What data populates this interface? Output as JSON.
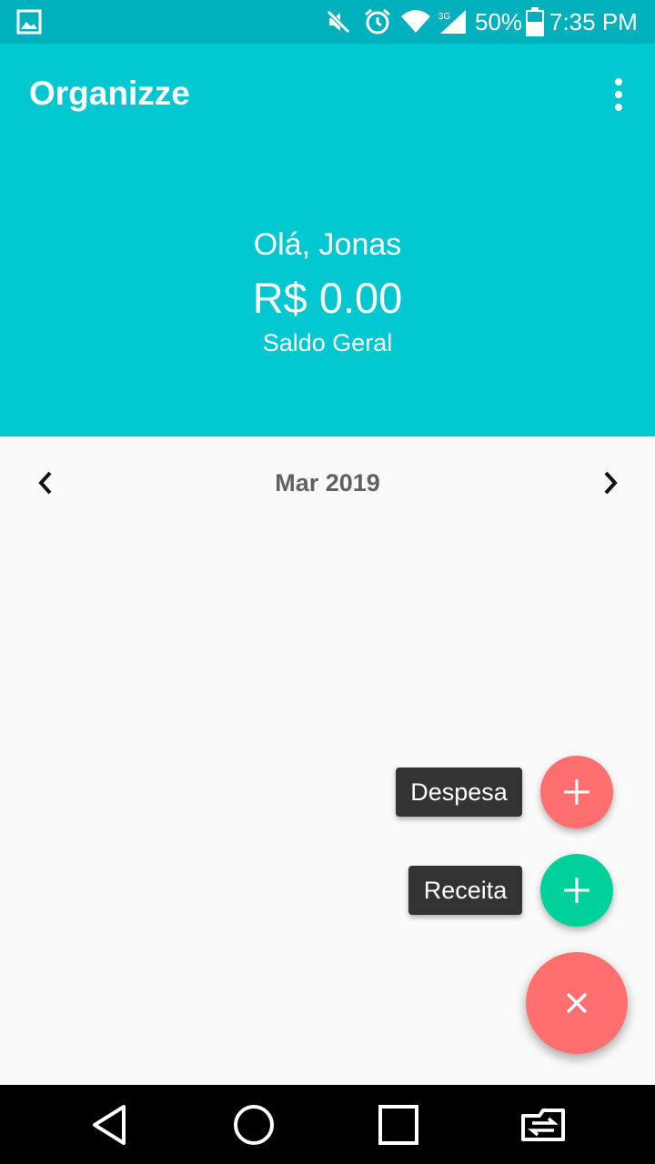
{
  "status_bar": {
    "battery": "50%",
    "time": "7:35 PM",
    "network": "3G",
    "icons": [
      "gallery-icon",
      "mute-icon",
      "alarm-icon",
      "wifi-icon",
      "signal-icon",
      "battery-icon"
    ]
  },
  "app": {
    "title": "Organizze",
    "color_primary": "#00c7d0",
    "color_status": "#00b0bd"
  },
  "header": {
    "greeting": "Olá, Jonas",
    "balance": "R$ 0.00",
    "balance_label": "Saldo Geral"
  },
  "month_nav": {
    "month": "Mar 2019",
    "prev_icon": "chevron-left-icon",
    "next_icon": "chevron-right-icon"
  },
  "fab_menu": {
    "expense_label": "Despesa",
    "income_label": "Receita",
    "expense_color": "#ff6f6f",
    "income_color": "#00d09c",
    "main_color": "#ff6f6f"
  },
  "nav_bar": {
    "icons": [
      "back-icon",
      "home-icon",
      "recents-icon",
      "switch-icon"
    ]
  }
}
